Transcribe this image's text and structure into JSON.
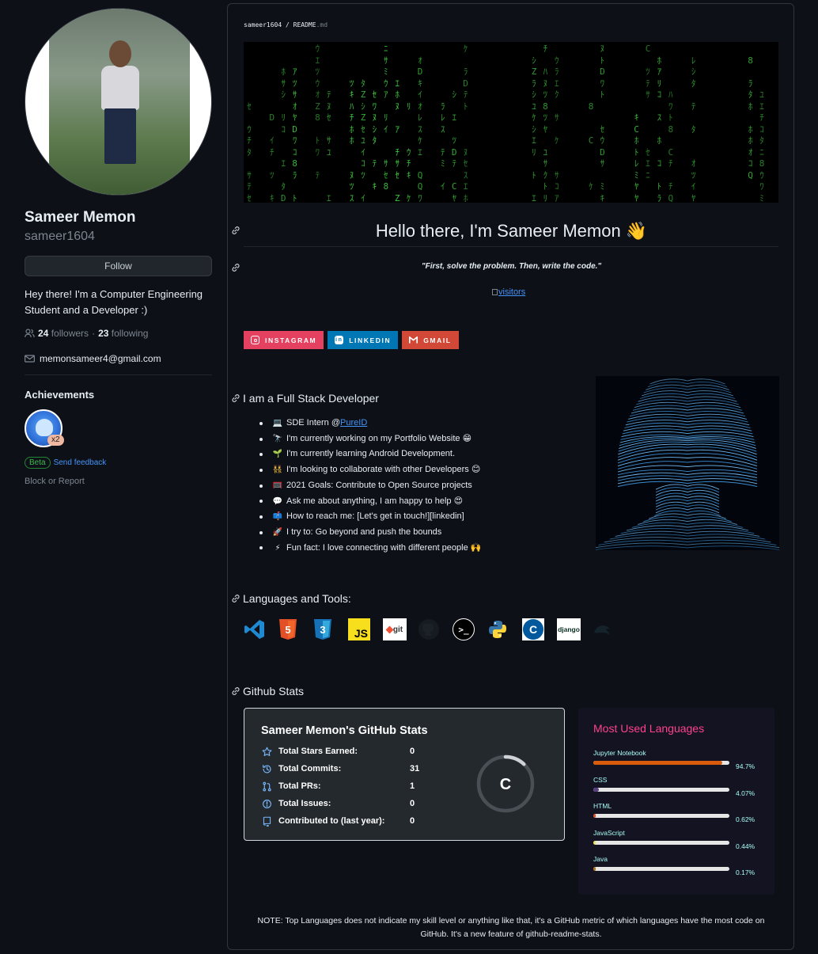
{
  "profile": {
    "name": "Sameer Memon",
    "username": "sameer1604",
    "follow_label": "Follow",
    "bio": "Hey there! I'm a Computer Engineering Student and a Developer :)",
    "followers_count": "24",
    "followers_label": "followers",
    "separator": "·",
    "following_count": "23",
    "following_label": "following",
    "email": "memonsameer4@gmail.com",
    "achievements_title": "Achievements",
    "badge_count": "x2",
    "beta_label": "Beta",
    "feedback_label": "Send feedback",
    "block_report": "Block or Report"
  },
  "readme": {
    "crumb_user": "sameer1604",
    "crumb_sep": "/",
    "crumb_file": "README",
    "crumb_ext": ".md",
    "hello": "Hello there, I'm Sameer Memon 👋",
    "quote": "\"First, solve the problem. Then, write the code.\"",
    "visitors_alt": "visitors",
    "socials": [
      "INSTAGRAM",
      "LINKEDIN",
      "GMAIL"
    ],
    "fullstack_heading": "I am a Full Stack Developer",
    "about": [
      {
        "emoji": "💻",
        "text": "SDE Intern @ ",
        "link": "PureID"
      },
      {
        "emoji": "🔭",
        "text": "I'm currently working on my Portfolio Website 😁",
        "link": ""
      },
      {
        "emoji": "🌱",
        "text": "I'm currently learning Android Development.",
        "link": ""
      },
      {
        "emoji": "👯",
        "text": "I'm looking to collaborate with other Developers 😊",
        "link": ""
      },
      {
        "emoji": "🥅",
        "text": "2021 Goals: Contribute to Open Source projects",
        "link": ""
      },
      {
        "emoji": "💬",
        "text": "Ask me about anything, I am happy to help 😍",
        "link": ""
      },
      {
        "emoji": "📫",
        "text": "How to reach me: [Let's get in touch!][linkedin]",
        "link": ""
      },
      {
        "emoji": "🚀",
        "text": "I try to: Go beyond and push the bounds",
        "link": ""
      },
      {
        "emoji": "⚡",
        "text": "Fun fact: I love connecting with different people 🙌",
        "link": ""
      }
    ],
    "tools_heading": "Languages and Tools:",
    "tool_icons": [
      "vscode-icon",
      "html5-icon",
      "css3-icon",
      "javascript-icon",
      "git-icon",
      "github-icon",
      "terminal-icon",
      "python-icon",
      "cplusplus-icon",
      "django-icon",
      "mysql-icon"
    ],
    "tool_labels": {
      "js": "JS",
      "git": "git",
      "terminal": ">_",
      "cpp": "C",
      "django": "django"
    },
    "stats_heading": "Github Stats",
    "note": "NOTE: Top Languages does not indicate my skill level or anything like that, it's a GitHub metric of which languages have the most code on GitHub. It's a new feature of github-readme-stats."
  },
  "github_stats": {
    "title": "Sameer Memon's GitHub Stats",
    "rows": [
      {
        "label": "Total Stars Earned:",
        "value": "0",
        "icon": "star-icon"
      },
      {
        "label": "Total Commits:",
        "value": "31",
        "icon": "history-icon"
      },
      {
        "label": "Total PRs:",
        "value": "1",
        "icon": "pull-request-icon"
      },
      {
        "label": "Total Issues:",
        "value": "0",
        "icon": "issue-icon"
      },
      {
        "label": "Contributed to (last year):",
        "value": "0",
        "icon": "repo-icon"
      }
    ],
    "rank": "C",
    "rank_progress": 0.12
  },
  "top_languages": {
    "title": "Most Used Languages",
    "languages": [
      {
        "name": "Jupyter Notebook",
        "percent": "94.7%",
        "value": 94.7,
        "color": "#DA5B0B"
      },
      {
        "name": "CSS",
        "percent": "4.07%",
        "value": 4.07,
        "color": "#563d7c"
      },
      {
        "name": "HTML",
        "percent": "0.62%",
        "value": 0.62,
        "color": "#e34c26"
      },
      {
        "name": "JavaScript",
        "percent": "0.44%",
        "value": 0.44,
        "color": "#f1e05a"
      },
      {
        "name": "Java",
        "percent": "0.17%",
        "value": 0.17,
        "color": "#b07219"
      }
    ]
  },
  "colors": {
    "background": "#0d1117",
    "link": "#4493f8",
    "matrix_green": "#3fcf3f",
    "instagram": "#E4405F",
    "linkedin": "#0077B5",
    "gmail": "#D14836",
    "stats_card_bg": "#24292e",
    "lang_card_bg": "#141321",
    "lang_title": "#fe428e",
    "lang_text": "#a9fef7"
  }
}
